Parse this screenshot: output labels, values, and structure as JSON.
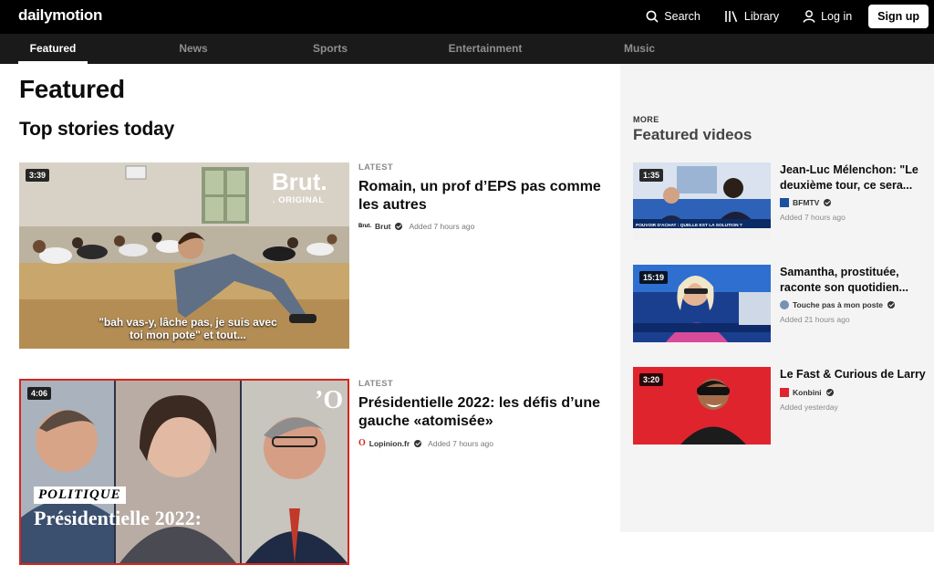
{
  "header": {
    "logo": "dailymotion",
    "search_label": "Search",
    "library_label": "Library",
    "login_label": "Log in",
    "signup_label": "Sign up"
  },
  "nav": {
    "tabs": [
      {
        "label": "Featured",
        "active": true
      },
      {
        "label": "News",
        "active": false
      },
      {
        "label": "Sports",
        "active": false
      },
      {
        "label": "Entertainment",
        "active": false
      },
      {
        "label": "Music",
        "active": false
      }
    ]
  },
  "main": {
    "page_title": "Featured",
    "section_title": "Top stories today",
    "stories": [
      {
        "duration": "3:39",
        "label": "LATEST",
        "title": "Romain, un prof d’EPS pas comme les autres",
        "channel": "Brut",
        "added": "Added 7 hours ago",
        "brand": "Brut.",
        "brand_sub": ". ORIGINAL",
        "caption": "\"bah vas-y, lâche pas, je suis avec toi mon pote\" et tout..."
      },
      {
        "duration": "4:06",
        "label": "LATEST",
        "title": "Présidentielle 2022: les défis d’une gauche «atomisée»",
        "channel": "Lopinion.fr",
        "added": "Added 7 hours ago",
        "brand": "’O",
        "tag": "POLITIQUE",
        "caption": "Présidentielle 2022:"
      }
    ]
  },
  "sidebar": {
    "kicker": "MORE",
    "title": "Featured videos",
    "videos": [
      {
        "duration": "1:35",
        "title": "Jean-Luc Mélenchon: \"Le deuxième tour, ce sera...",
        "channel": "BFMTV",
        "added": "Added 7 hours ago",
        "ticker": "POUVOIR D'ACHAT : QUELLE EST LA SOLUTION ?"
      },
      {
        "duration": "15:19",
        "title": "Samantha, prostituée, raconte son quotidien...",
        "channel": "Touche pas à mon poste",
        "added": "Added 21 hours ago"
      },
      {
        "duration": "3:20",
        "title": "Le Fast & Curious de Larry",
        "channel": "Konbini",
        "added": "Added yesterday"
      }
    ]
  },
  "colors": {
    "topbar": "#000000",
    "navbar": "#1a1a1a",
    "sidebar_bg": "#f4f4f4",
    "accent_red": "#d7261e"
  }
}
